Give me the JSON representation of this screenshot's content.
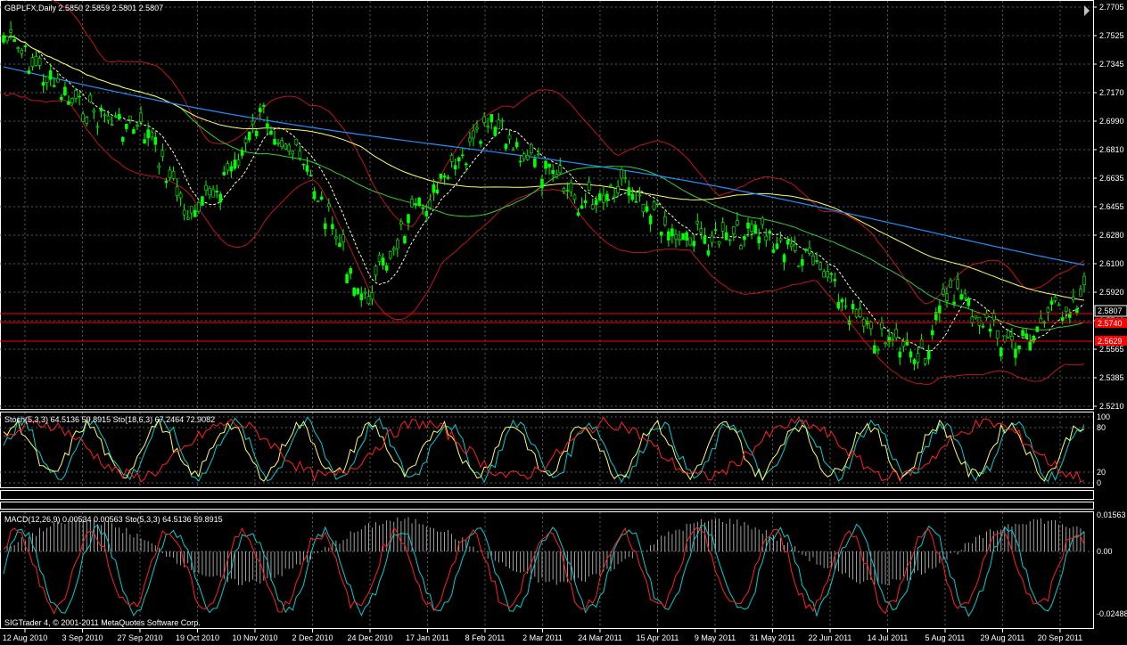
{
  "header": {
    "main_title": "GBPLFX,Daily  2.5850 2.5859 2.5801 2.5807",
    "stoch_title": "Stoch(5,3,3) 64.5136 59.8915  Sto(18,6,3) 67.2464 72.9082",
    "macd_title": "MACD(12,26,9) 0.00534 0.00563  Sto(5,3,3) 64.5136 59.8915",
    "copyright": "SIGTrader 4, © 2001-2011 MetaQuotes Software Corp."
  },
  "price_axis": {
    "ticks": [
      "2.7705",
      "2.7525",
      "2.7345",
      "2.7170",
      "2.6990",
      "2.6810",
      "2.6635",
      "2.6455",
      "2.6280",
      "2.6100",
      "2.5920",
      "2.5740",
      "2.5565",
      "2.5385",
      "2.5210"
    ],
    "current_price": "2.5807",
    "level_1": "2.5740",
    "level_2": "2.5629"
  },
  "stoch_axis": {
    "ticks": [
      "100",
      "80",
      "20",
      "0"
    ]
  },
  "macd_axis": {
    "ticks": [
      "0.01563",
      "0.00",
      "-0.02488"
    ]
  },
  "time_axis": {
    "labels": [
      "12 Aug 2010",
      "3 Sep 2010",
      "27 Sep 2010",
      "19 Oct 2010",
      "10 Nov 2010",
      "2 Dec 2010",
      "24 Dec 2010",
      "17 Jan 2011",
      "8 Feb 2011",
      "2 Mar 2011",
      "24 Mar 2011",
      "15 Apr 2011",
      "9 May 2011",
      "31 May 2011",
      "22 Jun 2011",
      "14 Jul 2011",
      "5 Aug 2011",
      "29 Aug 2011",
      "20 Sep 2011"
    ]
  },
  "colors": {
    "bull": "#00ff00",
    "bear": "#00ff00",
    "bollinger": "#c0141c",
    "ma_fast": "#ffff66",
    "ma_slow": "#1e90ff",
    "ma_mid": "#32cd32",
    "level": "#ff0000",
    "macd_main": "#00ced1",
    "macd_signal": "#ff2020"
  },
  "icons": {
    "scroll_toggle": "chart-shift-icon"
  }
}
